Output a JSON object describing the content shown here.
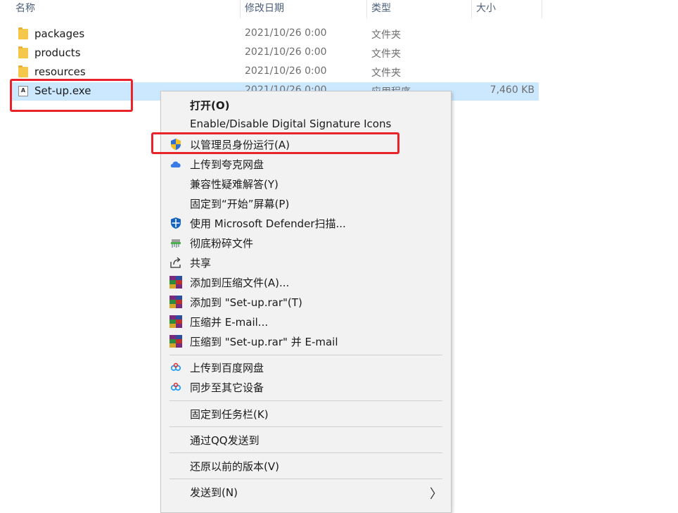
{
  "columns": {
    "name": "名称",
    "modified": "修改日期",
    "type": "类型",
    "size": "大小"
  },
  "files": [
    {
      "name": "packages",
      "date": "2021/10/26 0:00",
      "type": "文件夹",
      "size": "",
      "icon": "folder-icon"
    },
    {
      "name": "products",
      "date": "2021/10/26 0:00",
      "type": "文件夹",
      "size": "",
      "icon": "folder-icon"
    },
    {
      "name": "resources",
      "date": "2021/10/26 0:00",
      "type": "文件夹",
      "size": "",
      "icon": "folder-icon"
    },
    {
      "name": "Set-up.exe",
      "date": "2021/10/26 0:00",
      "type": "应用程序",
      "size": "7,460 KB",
      "icon": "adobe-exe-icon",
      "exe_icon_text": "A"
    }
  ],
  "context_menu": {
    "items": [
      {
        "label": "打开(O)",
        "icon": ""
      },
      {
        "label": "Enable/Disable Digital Signature Icons",
        "icon": ""
      },
      {
        "label": "以管理员身份运行(A)",
        "icon": "uac-shield-icon"
      },
      {
        "label": "上传到夸克网盘",
        "icon": "quark-cloud-icon"
      },
      {
        "label": "兼容性疑难解答(Y)",
        "icon": ""
      },
      {
        "label": "固定到“开始”屏幕(P)",
        "icon": ""
      },
      {
        "label": "使用 Microsoft Defender扫描...",
        "icon": "defender-shield-icon"
      },
      {
        "label": "彻底粉碎文件",
        "icon": "shredder-icon"
      },
      {
        "label": "共享",
        "icon": "share-icon"
      },
      {
        "label": "添加到压缩文件(A)...",
        "icon": "winrar-icon"
      },
      {
        "label": "添加到 \"Set-up.rar\"(T)",
        "icon": "winrar-icon"
      },
      {
        "label": "压缩并 E-mail...",
        "icon": "winrar-icon"
      },
      {
        "label": "压缩到 \"Set-up.rar\" 并 E-mail",
        "icon": "winrar-icon"
      },
      {
        "label": "上传到百度网盘",
        "icon": "baidu-cloud-icon"
      },
      {
        "label": "同步至其它设备",
        "icon": "baidu-cloud-icon"
      },
      {
        "label": "固定到任务栏(K)",
        "icon": ""
      },
      {
        "label": "通过QQ发送到",
        "icon": ""
      },
      {
        "label": "还原以前的版本(V)",
        "icon": ""
      },
      {
        "label": "发送到(N)",
        "icon": "",
        "submenu_arrow": "〉"
      }
    ]
  },
  "colors": {
    "selection": "#cce8ff",
    "annotation": "#e8232a",
    "menu_bg": "#f2f2f2"
  }
}
